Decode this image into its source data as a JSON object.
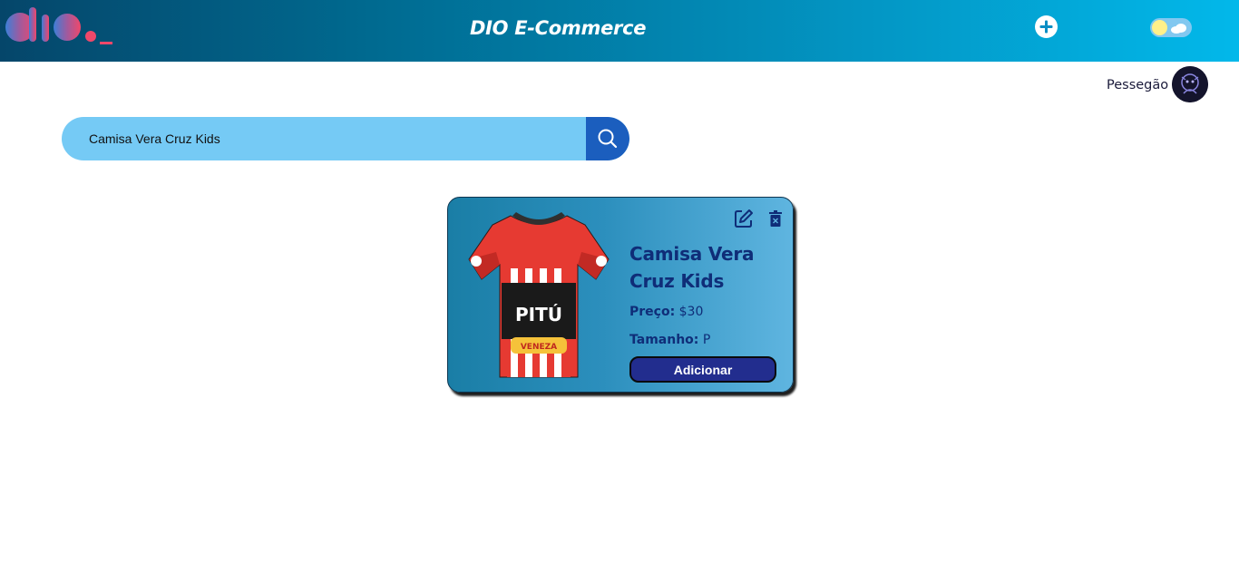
{
  "header": {
    "title": "DIO E-Commerce",
    "logo_icon": "dio-logo-icon",
    "add_icon": "plus-circle-icon",
    "theme_icon": "sun-cloud-toggle-icon"
  },
  "user": {
    "name": "Pessegão",
    "avatar_icon": "avatar-icon"
  },
  "search": {
    "value": "Camisa Vera Cruz Kids",
    "button_icon": "search-icon"
  },
  "products": [
    {
      "name": "Camisa Vera Cruz Kids",
      "price_label": "Preço:",
      "price": "$30",
      "size_label": "Tamanho:",
      "size": "P",
      "add_label": "Adicionar",
      "shirt_text": "PITÚ",
      "shirt_sponsor": "VENEZA",
      "edit_icon": "edit-icon",
      "delete_icon": "trash-icon"
    }
  ],
  "colors": {
    "header_start": "#05466a",
    "header_end": "#02b8ea",
    "search_bg": "#75caf5",
    "search_button": "#1b5ebe",
    "card_text": "#0f2d78",
    "add_button": "#222d8e"
  }
}
